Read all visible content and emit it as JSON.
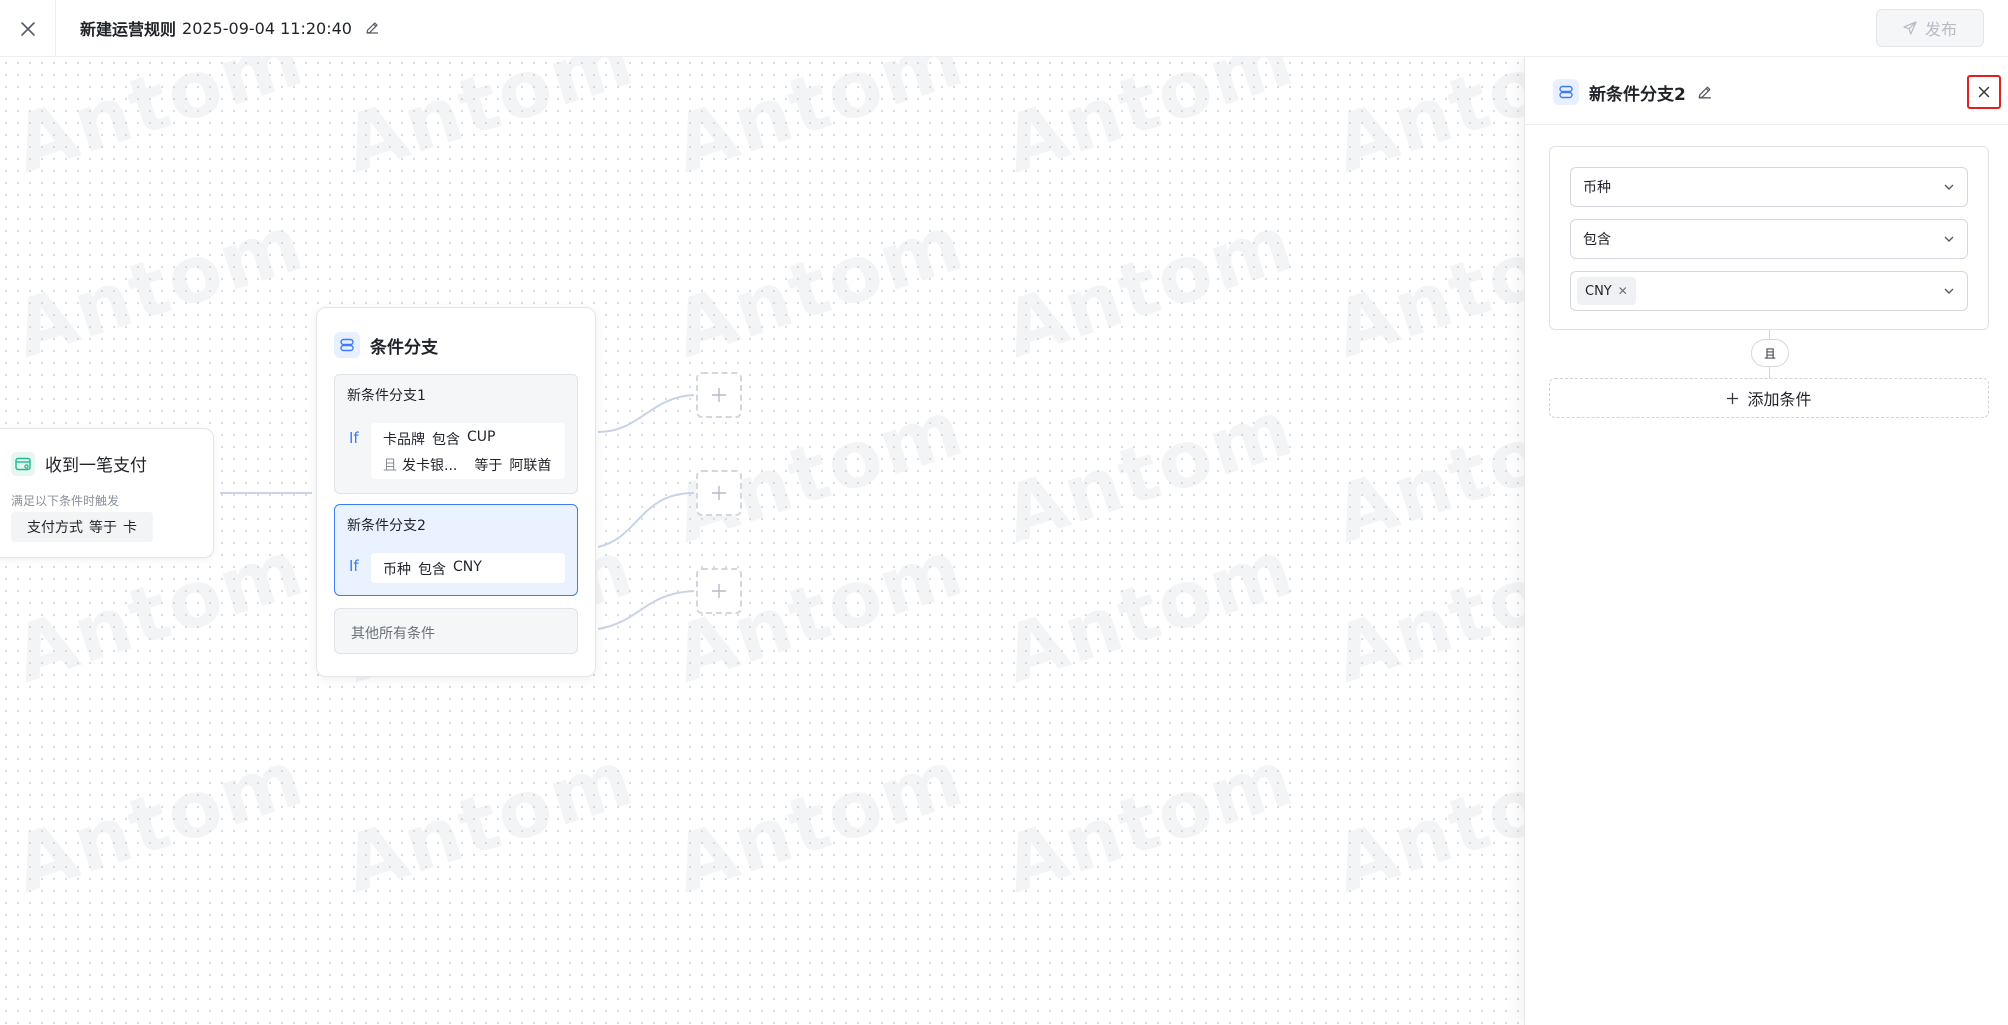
{
  "header": {
    "title": "新建运营规则",
    "timestamp": "2025-09-04 11:20:40",
    "publish_label": "发布"
  },
  "watermark": "Antom",
  "trigger": {
    "title": "收到一笔支付",
    "subtitle": "满足以下条件时触发",
    "condition": {
      "field": "支付方式",
      "operator": "等于",
      "value": "卡"
    }
  },
  "branch": {
    "title": "条件分支",
    "if_label": "If",
    "items": [
      {
        "name": "新条件分支1",
        "conditions": [
          {
            "prefix": "",
            "field": "卡品牌",
            "operator": "包含",
            "value": "CUP"
          },
          {
            "prefix": "且",
            "field": "发卡银...",
            "operator": "等于",
            "value": "阿联酋"
          }
        ]
      },
      {
        "name": "新条件分支2",
        "conditions": [
          {
            "prefix": "",
            "field": "币种",
            "operator": "包含",
            "value": "CNY"
          }
        ]
      }
    ],
    "else_label": "其他所有条件"
  },
  "panel": {
    "title": "新条件分支2",
    "field_select": "币种",
    "operator_select": "包含",
    "value_tags": [
      "CNY"
    ],
    "and_label": "且",
    "add_condition_label": "添加条件"
  },
  "colors": {
    "accent": "#3d7bf7",
    "selected_bg": "#eaf2ff",
    "close_highlight": "#e02020",
    "trigger_icon": "#1fb88a"
  },
  "icons": {
    "header_close": "close-icon",
    "title_edit": "pencil-icon",
    "publish": "send-icon",
    "trigger": "credit-card-icon",
    "branch": "branch-stack-icon",
    "add": "plus-icon",
    "select_arrow": "chevron-down-icon"
  }
}
